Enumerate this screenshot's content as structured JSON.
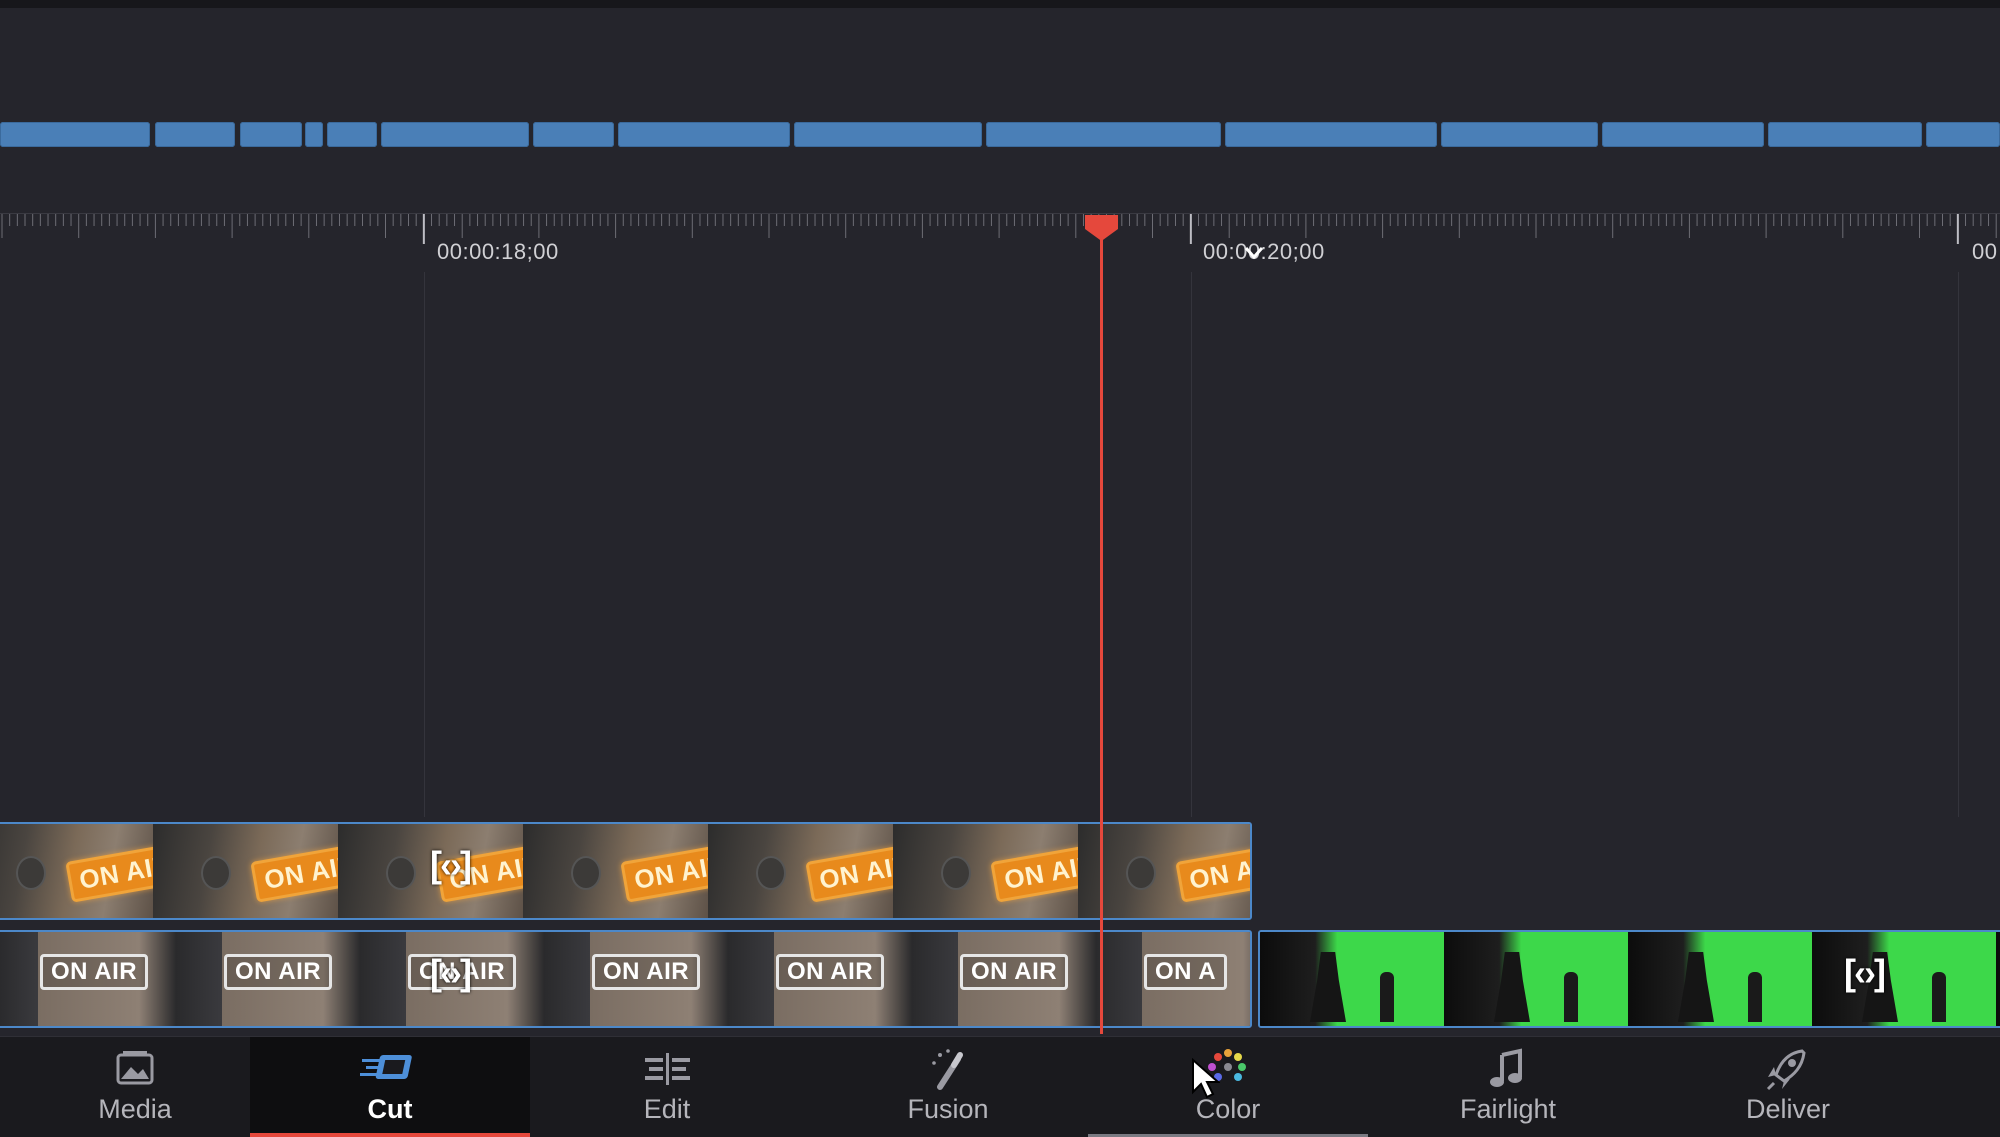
{
  "timeline": {
    "ruler": {
      "timecode_1": "00:00:18;00",
      "timecode_2": "00:00:20;00",
      "timecode_3": "00"
    },
    "upper_track": {
      "clip_label": "ON AIR",
      "trim_handle": "[‹›]"
    },
    "lower_track": {
      "clip_label": "ON AIR",
      "clip_label_partial": "ON A",
      "trim_handle_1": "[‹›]",
      "trim_handle_2": "[‹›]"
    },
    "colors": {
      "background": "#25252c",
      "clip_blue": "#4a7fb7",
      "track_border": "#4c88c9",
      "playhead": "#e5483c",
      "green_screen": "#3dd84a"
    }
  },
  "pages": {
    "media": {
      "label": "Media",
      "icon": "media-pool-icon"
    },
    "cut": {
      "label": "Cut",
      "icon": "cut-page-icon",
      "active": true
    },
    "edit": {
      "label": "Edit",
      "icon": "edit-page-icon"
    },
    "fusion": {
      "label": "Fusion",
      "icon": "fusion-wand-icon"
    },
    "color": {
      "label": "Color",
      "icon": "color-wheels-icon"
    },
    "fairlight": {
      "label": "Fairlight",
      "icon": "music-note-icon"
    },
    "deliver": {
      "label": "Deliver",
      "icon": "rocket-icon"
    }
  }
}
